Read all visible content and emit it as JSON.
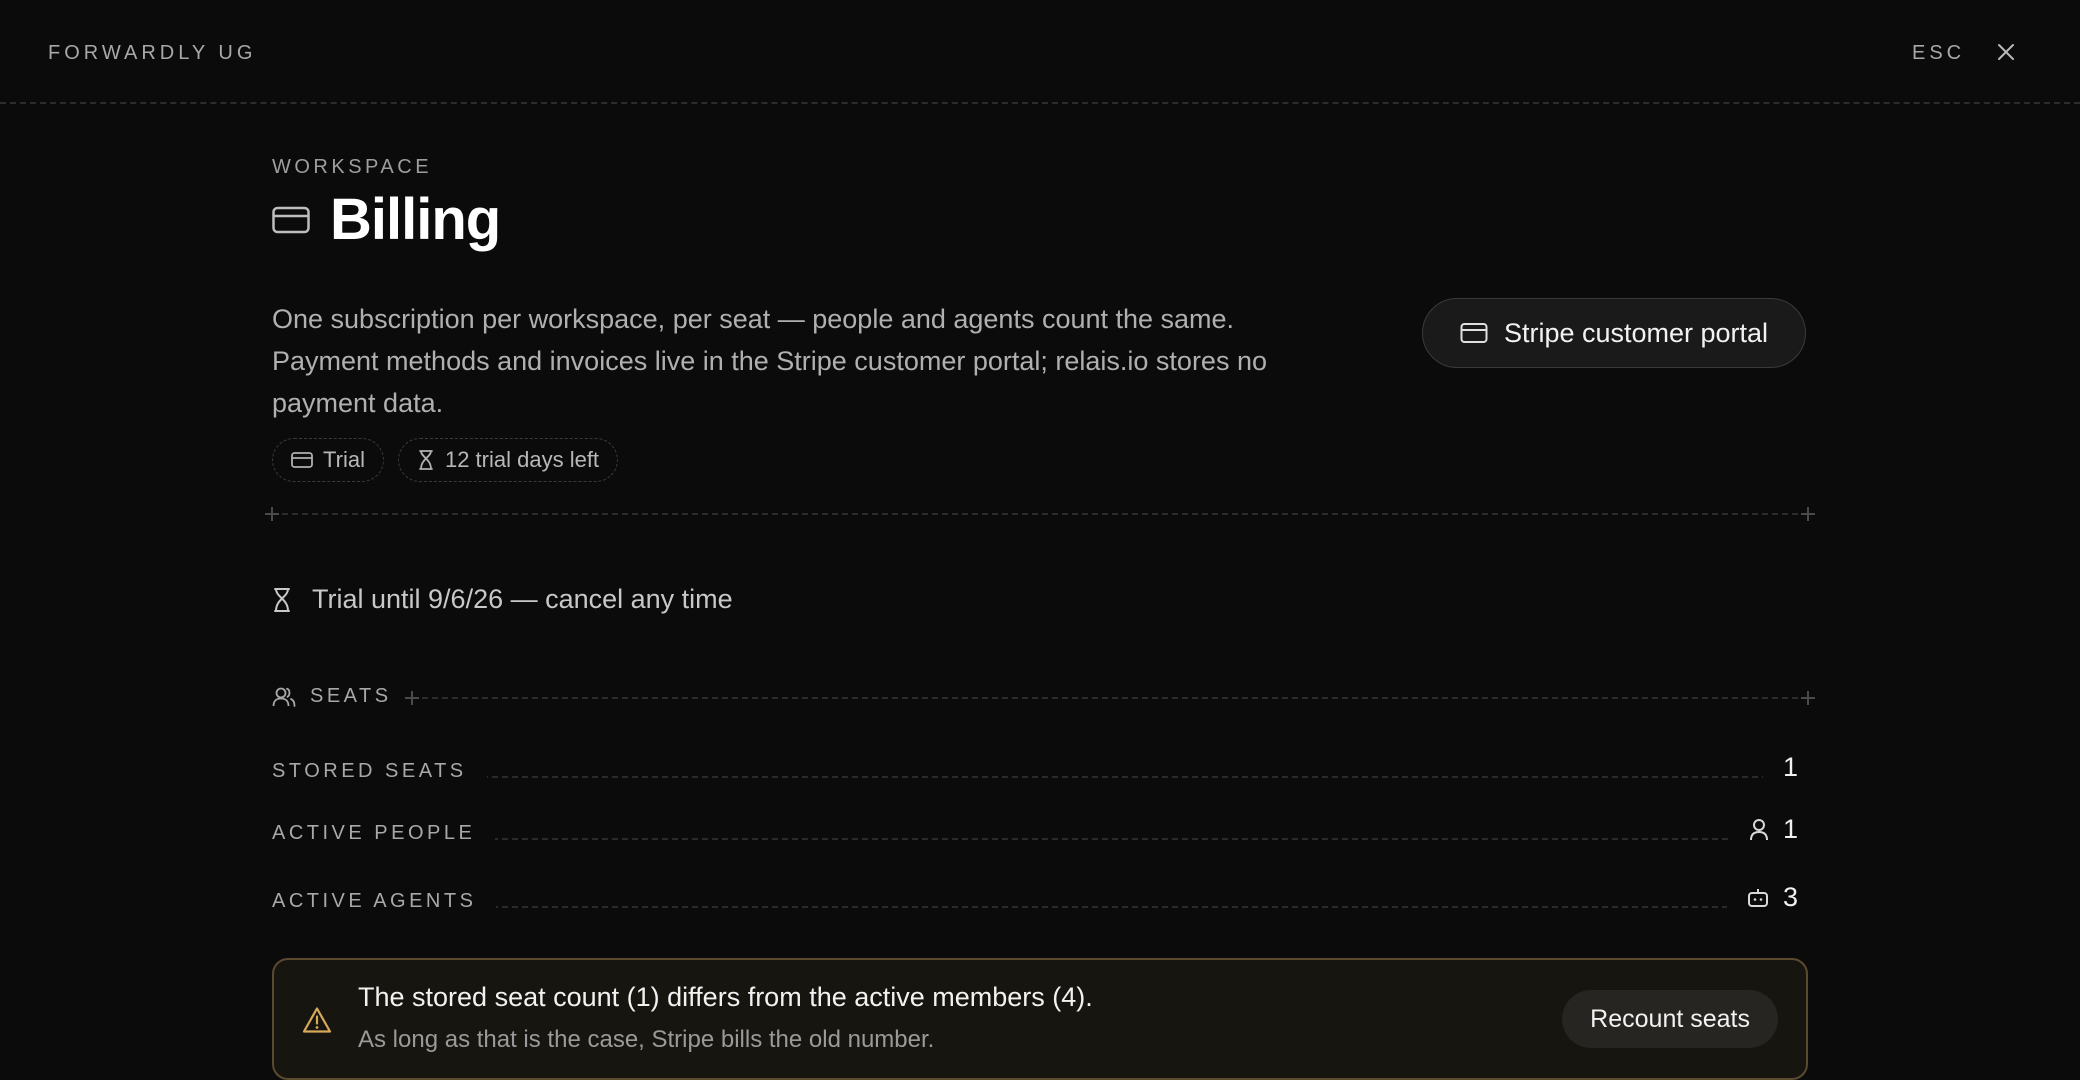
{
  "header": {
    "org_name": "FORWARDLY UG",
    "esc_label": "ESC"
  },
  "page": {
    "eyebrow": "WORKSPACE",
    "title": "Billing",
    "description": "One subscription per workspace, per seat — people and agents count the same. Payment methods and invoices live in the Stripe customer portal; relais.io stores no payment data.",
    "portal_button": "Stripe customer portal",
    "badges": {
      "plan": "Trial",
      "days_left": "12 trial days left"
    },
    "trial_line": "Trial until 9/6/26 — cancel any time"
  },
  "seats": {
    "heading": "SEATS",
    "rows": [
      {
        "label": "STORED SEATS",
        "value": "1"
      },
      {
        "label": "ACTIVE PEOPLE",
        "value": "1",
        "icon": "user-icon"
      },
      {
        "label": "ACTIVE AGENTS",
        "value": "3",
        "icon": "bot-icon"
      }
    ]
  },
  "warning": {
    "title": "The stored seat count (1) differs from the active members (4).",
    "subtitle": "As long as that is the case, Stripe bills the old number.",
    "button": "Recount seats",
    "icon": "warning-icon"
  },
  "colors": {
    "background": "#0b0b0b",
    "warning_border": "#5a4a2e",
    "warning_icon": "#d6a85a"
  }
}
